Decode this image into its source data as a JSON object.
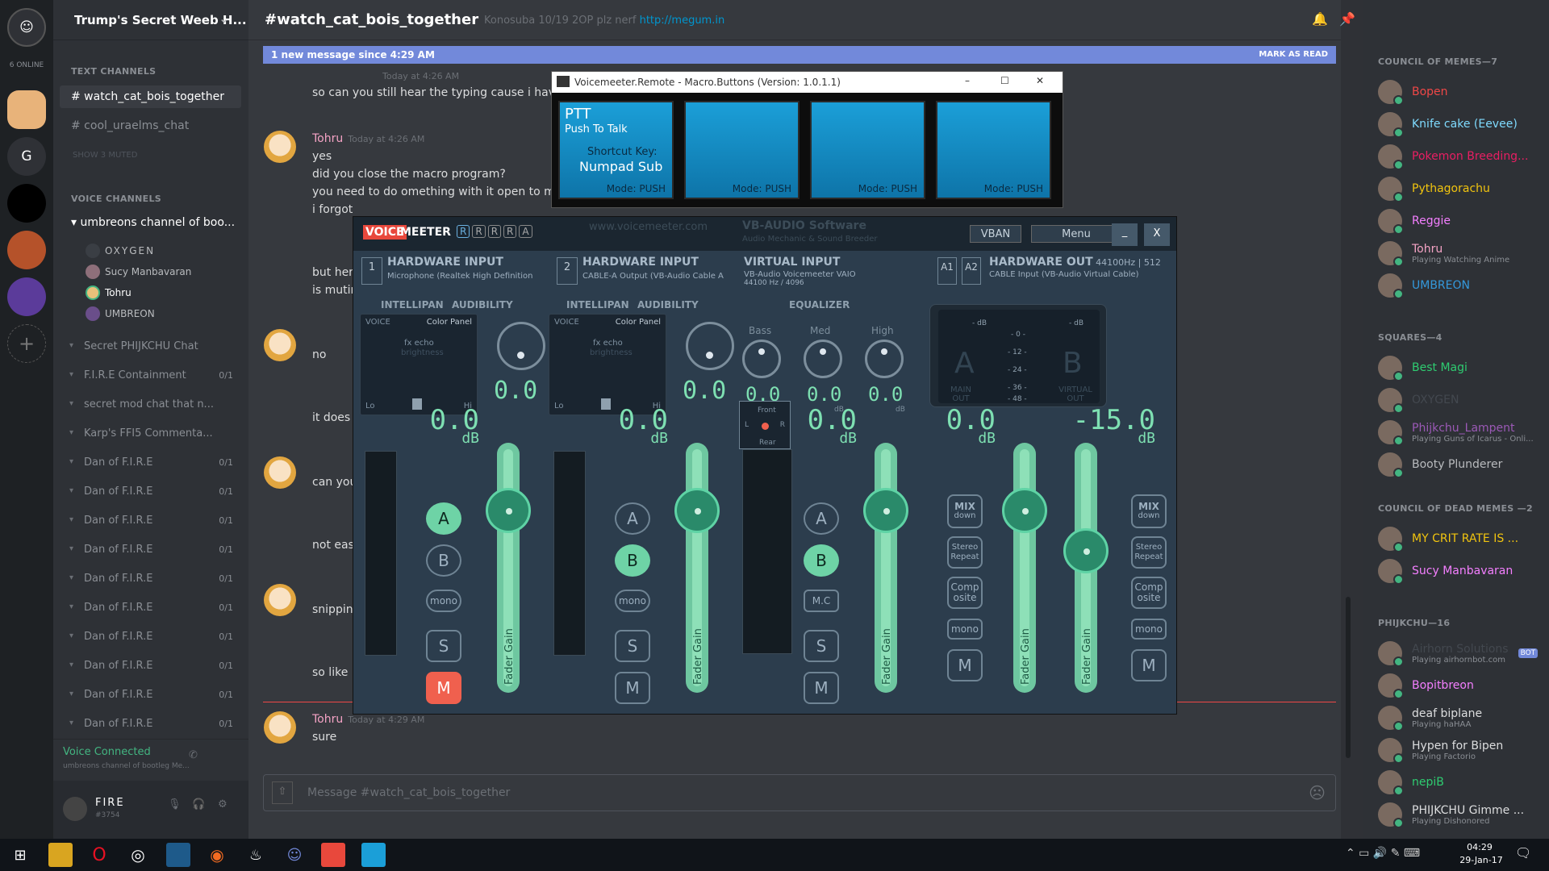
{
  "server": {
    "name": "Trump's Secret Weeb H...",
    "online": "6 ONLINE",
    "letter_g": "G"
  },
  "channels": {
    "text_cat": "TEXT CHANNELS",
    "text": [
      "# watch_cat_bois_together",
      "# cool_uraelms_chat"
    ],
    "show_muted": "SHOW 3 MUTED",
    "voice_cat": "VOICE CHANNELS",
    "voice_open": "umbreons channel of boo...",
    "voice_members": [
      "OXYGEN",
      "Sucy Manbavaran",
      "Tohru",
      "UMBREON"
    ],
    "collapsed": [
      {
        "name": "Secret PHIJKCHU Chat",
        "count": ""
      },
      {
        "name": "F.I.R.E Containment",
        "count": "0/1"
      },
      {
        "name": "secret mod chat that n...",
        "count": ""
      },
      {
        "name": "Karp's FFI5 Commenta...",
        "count": ""
      },
      {
        "name": "Dan of F.I.R.E",
        "count": "0/1"
      },
      {
        "name": "Dan of F.I.R.E",
        "count": "0/1"
      },
      {
        "name": "Dan of F.I.R.E",
        "count": "0/1"
      },
      {
        "name": "Dan of F.I.R.E",
        "count": "0/1"
      },
      {
        "name": "Dan of F.I.R.E",
        "count": "0/1"
      },
      {
        "name": "Dan of F.I.R.E",
        "count": "0/1"
      },
      {
        "name": "Dan of F.I.R.E",
        "count": "0/1"
      },
      {
        "name": "Dan of F.I.R.E",
        "count": "0/1"
      },
      {
        "name": "Dan of F.I.R.E",
        "count": "0/1"
      },
      {
        "name": "Dan of F.I.R.E",
        "count": "0/1"
      }
    ]
  },
  "voice_connected": {
    "status": "Voice Connected",
    "channel": "umbreons channel of bootleg Me..."
  },
  "user": {
    "name": "FIRE",
    "tag": "#3754"
  },
  "topbar": {
    "channel": "#watch_cat_bois_together",
    "topic": "Konosuba 10/19 2OP plz nerf",
    "link": "http://megum.in"
  },
  "newbar": {
    "text": "1 new message since 4:29 AM",
    "mark": "MARK AS READ"
  },
  "messages": {
    "t0": "Today at 4:26 AM",
    "m0": "so can you still hear the typing cause i have no i",
    "author": "Tohru",
    "t1": "Today at 4:26 AM",
    "m1a": "yes",
    "m1b": "did you close the macro program?",
    "m1c": "you need to do omething with it open to make it",
    "m1d": "i forgot",
    "m2a": "but here",
    "m2b": "is mutin",
    "m3": "no",
    "m3b": "it does",
    "m4": "can you",
    "m4b": "not easi",
    "m5": "snipping",
    "m5b": "so like p",
    "t6": "Today at 4:29 AM",
    "m6": "sure"
  },
  "input": {
    "placeholder": "Message #watch_cat_bois_together"
  },
  "members": {
    "cat1": "COUNCIL OF MEMES—7",
    "list1": [
      {
        "name": "Bopen",
        "color": "#f04747",
        "sub": ""
      },
      {
        "name": "Knife cake (Eevee)",
        "color": "#7fdbff",
        "sub": ""
      },
      {
        "name": "Pokemon Breeding...",
        "color": "#e91e63",
        "sub": ""
      },
      {
        "name": "Pythagorachu",
        "color": "#f1c40f",
        "sub": ""
      },
      {
        "name": "Reggie",
        "color": "#f47fff",
        "sub": ""
      },
      {
        "name": "Tohru",
        "color": "#f5a3c5",
        "sub": "Playing Watching Anime"
      },
      {
        "name": "UMBREON",
        "color": "#3498db",
        "sub": ""
      }
    ],
    "cat2": "SQUARES—4",
    "list2": [
      {
        "name": "Best Magi",
        "color": "#2ecc71",
        "sub": ""
      },
      {
        "name": "OXYGEN",
        "color": "#43484f",
        "sub": ""
      },
      {
        "name": "Phijkchu_Lampent",
        "color": "#9b59b6",
        "sub": "Playing Guns of Icarus - Onli..."
      },
      {
        "name": "Booty Plunderer",
        "color": "#b9bbbe",
        "sub": ""
      }
    ],
    "cat3": "COUNCIL OF DEAD MEMES —2",
    "list3": [
      {
        "name": "MY CRIT RATE IS ...",
        "color": "#f1c40f",
        "sub": ""
      },
      {
        "name": "Sucy Manbavaran",
        "color": "#f47fff",
        "sub": ""
      }
    ],
    "cat4": "PHIJKCHU—16",
    "list4": [
      {
        "name": "Airhorn Solutions",
        "color": "#43484f",
        "sub": "Playing airhornbot.com",
        "bot": "BOT"
      },
      {
        "name": "Bopitbreon",
        "color": "#f47fff",
        "sub": ""
      },
      {
        "name": "deaf biplane",
        "color": "#dcddde",
        "sub": "Playing haHAA"
      },
      {
        "name": "Hypen for Bipen",
        "color": "#dcddde",
        "sub": "Playing Factorio"
      },
      {
        "name": "nepiB",
        "color": "#2ecc71",
        "sub": ""
      },
      {
        "name": "PHIJKCHU Gimme ...",
        "color": "#dcddde",
        "sub": "Playing Dishonored"
      }
    ]
  },
  "remote": {
    "title": "Voicemeeter.Remote - Macro.Buttons (Version: 1.0.1.1)",
    "btn1_title": "PTT",
    "btn1_sub": "Push To Talk",
    "btn1_sk": "Shortcut Key:",
    "btn1_key": "Numpad Sub",
    "mode": "Mode: PUSH"
  },
  "voicemeeter": {
    "logo_voice": "VOICE",
    "logo_meeter": "MEETER",
    "badges": [
      "R",
      "R",
      "R",
      "R",
      "A"
    ],
    "vban": "VBAN",
    "menu": "Menu",
    "min": "_",
    "close": "X",
    "hw1": {
      "num": "1",
      "title": "HARDWARE INPUT",
      "dev": "Microphone (Realtek High Definition A"
    },
    "hw2": {
      "num": "2",
      "title": "HARDWARE INPUT",
      "dev": "CABLE-A Output (VB-Audio Cable A"
    },
    "vin": {
      "title": "VIRTUAL INPUT",
      "dev": "VB-Audio Voicemeeter VAIO",
      "fmt": "44100 Hz / 4096"
    },
    "hout": {
      "a1": "A1",
      "a2": "A2",
      "title": "HARDWARE OUT",
      "fmt": "44100Hz | 512",
      "dev": "CABLE Input (VB-Audio Virtual Cable)"
    },
    "intellipan": "INTELLIPAN",
    "audibility": "AUDIBILITY",
    "equalizer": "EQUALIZER",
    "voice": "VOICE",
    "color_panel": "Color Panel",
    "fx_echo": "fx echo",
    "brightness": "brightness",
    "lo": "Lo",
    "hi": "Hi",
    "bass": "Bass",
    "med": "Med",
    "high": "High",
    "aud1": "0.0",
    "aud2": "0.0",
    "eq_vals": [
      "0.0",
      "0.0",
      "0.0"
    ],
    "db_small": "dB",
    "gains": [
      "0.0",
      "0.0",
      "0.0",
      "0.0",
      "-15.0"
    ],
    "db": "dB",
    "fader_gain": "Fader Gain",
    "btn_a": "A",
    "btn_b": "B",
    "btn_mono": "mono",
    "btn_s": "S",
    "btn_m": "M",
    "btn_mc": "M.C",
    "mix": "MIX",
    "down": "down",
    "stereo": "Stereo",
    "repeat": "Repeat",
    "comp": "Comp",
    "osite": "osite",
    "front": "Front",
    "rear": "Rear",
    "l": "L",
    "r": "R",
    "meter_a": "A",
    "meter_b": "B",
    "main_out": "MAIN OUT",
    "virtual_out": "VIRTUAL OUT",
    "meter_scale": [
      "- dB",
      "- 0 -",
      "- 12 -",
      "- 24 -",
      "- 36 -",
      "- 48 -",
      "- dB"
    ],
    "vb_brand": "VB-AUDIO Software",
    "vb_sub": "Audio Mechanic & Sound Breeder",
    "site": "www.voicemeeter.com"
  },
  "taskbar": {
    "time": "04:29",
    "date": "29-Jan-17"
  }
}
